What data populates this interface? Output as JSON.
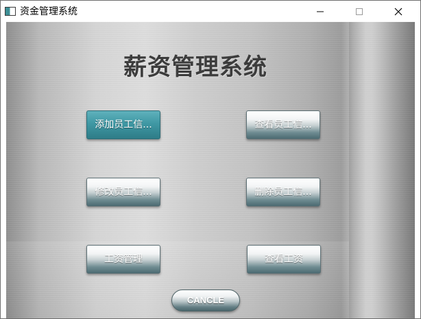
{
  "window": {
    "title": "资金管理系统",
    "icon": "app-window-icon",
    "controls": {
      "minimize_icon": "minimize-icon",
      "maximize_icon": "maximize-icon",
      "close_icon": "close-icon"
    }
  },
  "main": {
    "title": "薪资管理系统",
    "buttons": {
      "add_employee": "添加员工信...",
      "view_employee": "查看员工信...",
      "edit_employee": "修改员工信...",
      "delete_employee": "删除员工信...",
      "salary_manage": "工资管理",
      "view_salary": "查看工资"
    },
    "cancel_label": "CANCLE"
  },
  "colors": {
    "active_button": "#3f98a4",
    "button_dark": "#4c6b72",
    "title_text": "#3c3c3c"
  }
}
